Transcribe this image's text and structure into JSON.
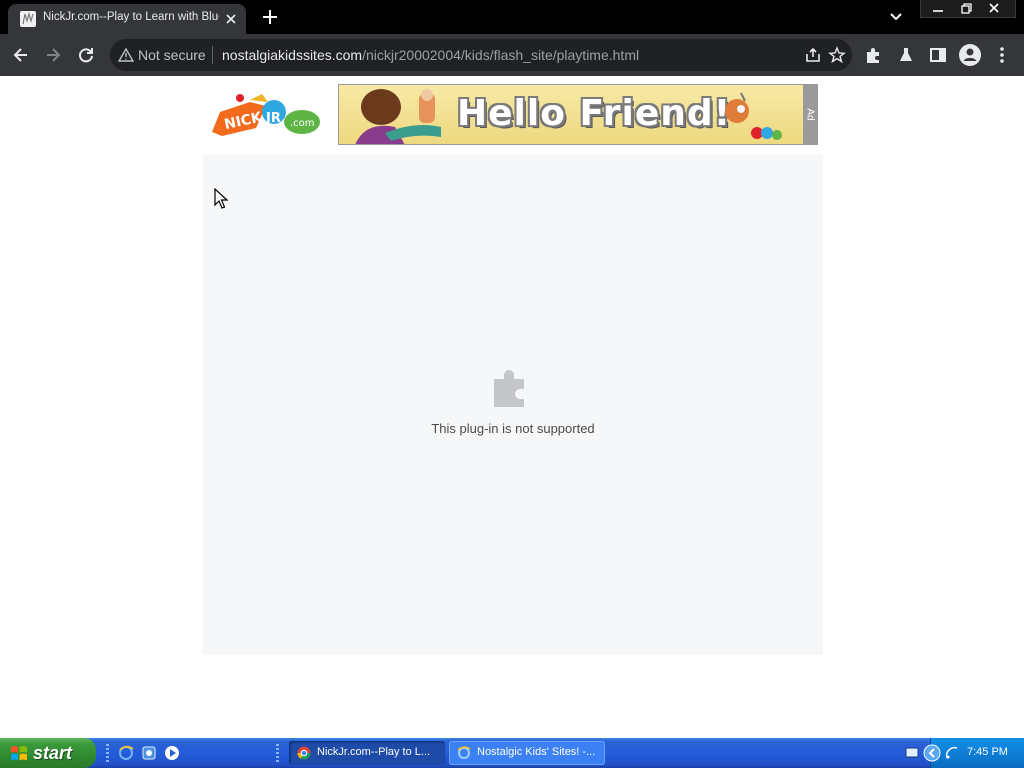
{
  "browser": {
    "tab": {
      "title": "NickJr.com--Play to Learn with Blue's Clues"
    },
    "omnibox": {
      "security_label": "Not secure",
      "url_host": "nostalgiakidssites.com",
      "url_path": "/nickjr20002004/kids/flash_site/playtime.html"
    }
  },
  "page": {
    "ad": {
      "headline": "Hello Friend!",
      "tag": "Ad"
    },
    "plugin_message": "This plug-in is not supported"
  },
  "taskbar": {
    "start_label": "start",
    "tasks": [
      {
        "label": "NickJr.com--Play to L...",
        "icon": "chrome-icon",
        "active": true
      },
      {
        "label": "Nostalgic Kids' Sites! -...",
        "icon": "ie-icon",
        "active": false
      }
    ],
    "clock": "7:45 PM"
  },
  "colors": {
    "tab_strip": "#000000",
    "toolbar": "#35363a",
    "omnibox": "#202124",
    "plugin_bg": "#f6f7f8",
    "taskbar_blue": "#245ddb",
    "start_green": "#3c9a3c"
  }
}
